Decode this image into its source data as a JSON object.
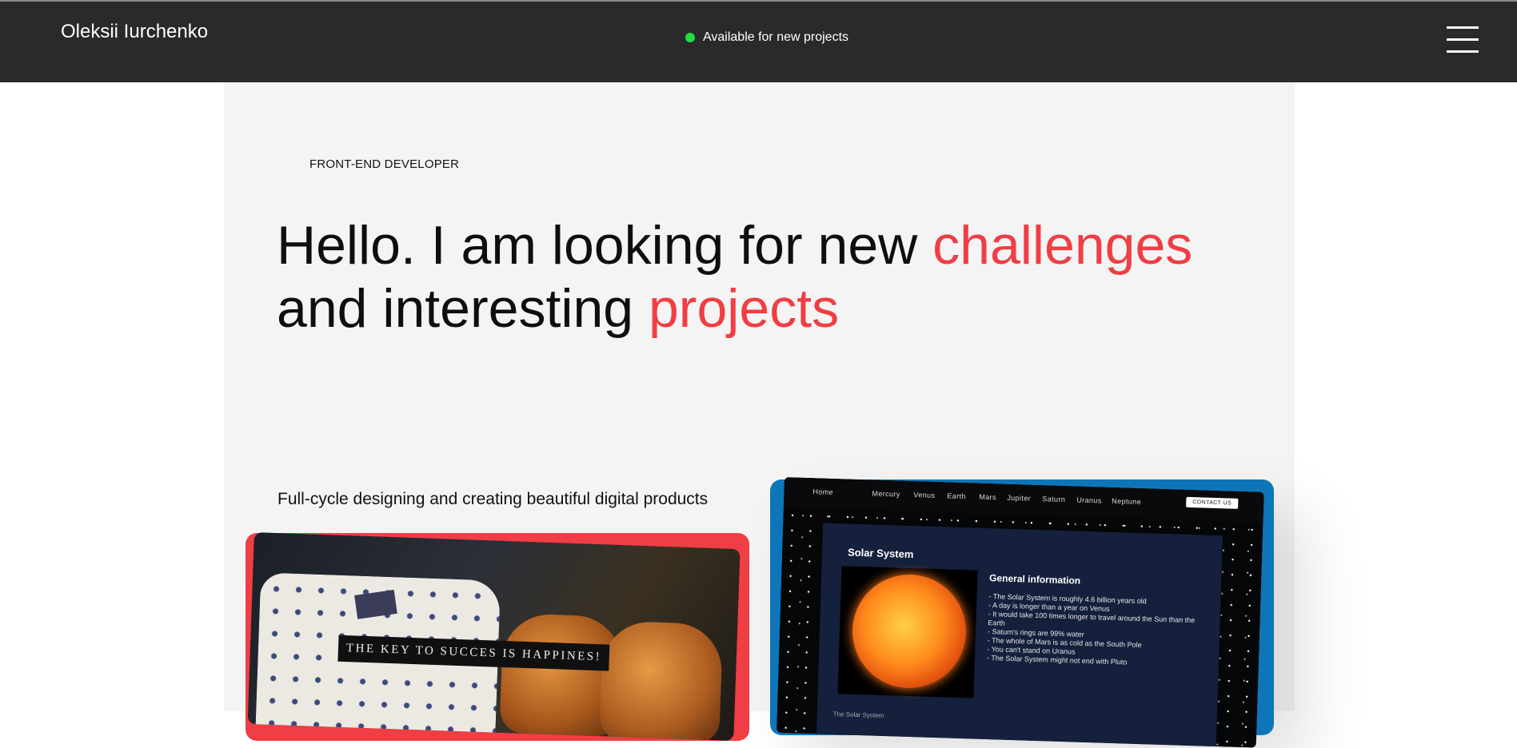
{
  "header": {
    "brand": "Oleksii Iurchenko",
    "status_text": "Available for new projects",
    "status_color": "#22dd44",
    "menu_icon": "hamburger-menu-icon"
  },
  "hero": {
    "eyebrow": "FRONT-END DEVELOPER",
    "headline": {
      "part1": "Hello. I am looking for new ",
      "accent1": "challenges",
      "part2": " and interesting ",
      "accent2": "projects"
    },
    "accent_color": "#ef3e44",
    "subline": "Full-cycle designing and creating beautiful digital products"
  },
  "projects": {
    "shop": {
      "banner": "THE KEY TO SUCCES IS HAPPINES!",
      "frame_color": "#ef3e44"
    },
    "solar": {
      "frame_color": "#0e76b8",
      "nav": [
        "Home",
        "Mercury",
        "Venus",
        "Earth",
        "Mars",
        "Jupiter",
        "Saturn",
        "Uranus",
        "Neptune"
      ],
      "contact": "CONTACT US",
      "title": "Solar System",
      "info_title": "General information",
      "facts": [
        "- The Solar System is roughly 4.6 billion years old",
        "- A day is longer than a year on Venus",
        "- It would take 100 times longer to travel around the Sun than the Earth",
        "- Saturn's rings are 99% water",
        "- The whole of Mars is as cold as the South Pole",
        "- You can't stand on Uranus",
        "- The Solar System might not end with Pluto"
      ],
      "footer": "The Solar System"
    }
  }
}
